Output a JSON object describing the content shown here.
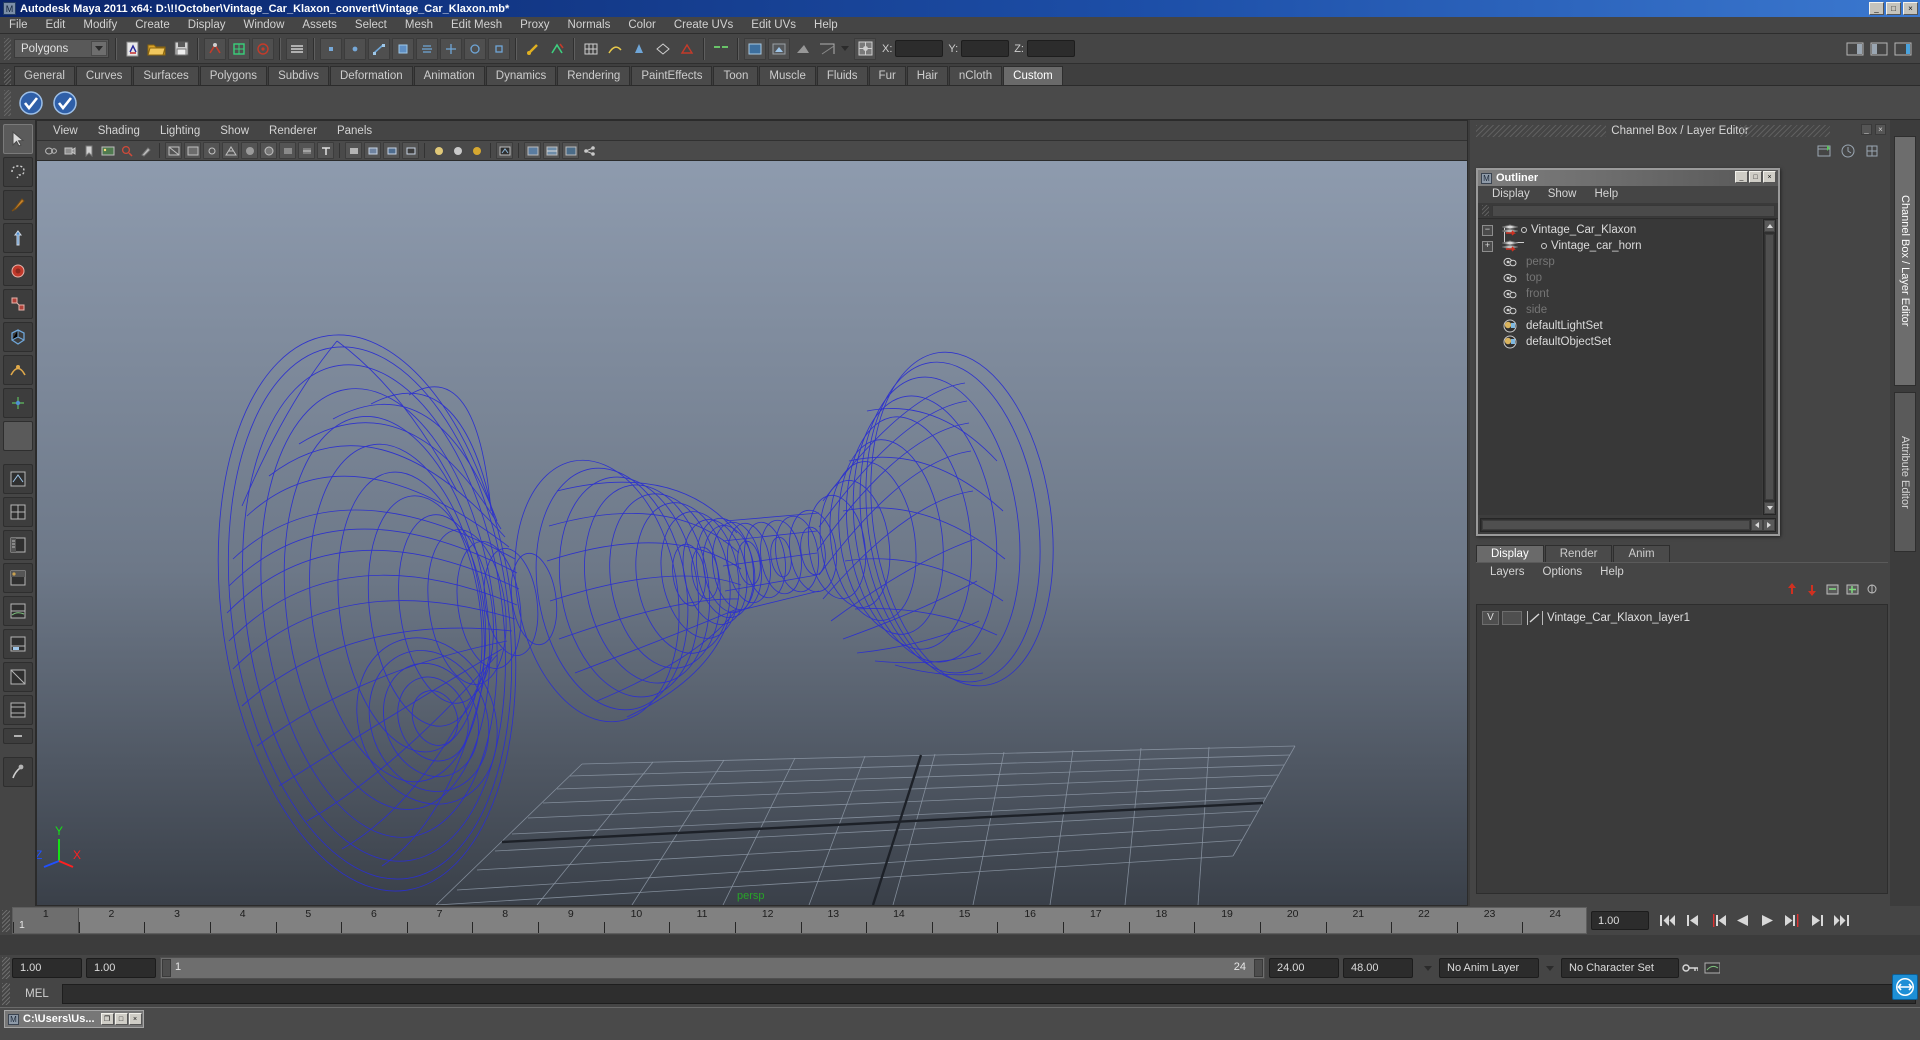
{
  "window": {
    "title": "Autodesk Maya 2011 x64: D:\\!!October\\Vintage_Car_Klaxon_convert\\Vintage_Car_Klaxon.mb*",
    "app_icon": "maya-icon",
    "minimize": "_",
    "maximize": "□",
    "close": "×"
  },
  "menubar": {
    "items": [
      {
        "label": "File"
      },
      {
        "label": "Edit"
      },
      {
        "label": "Modify"
      },
      {
        "label": "Create"
      },
      {
        "label": "Display"
      },
      {
        "label": "Window"
      },
      {
        "label": "Assets"
      },
      {
        "label": "Select"
      },
      {
        "label": "Mesh"
      },
      {
        "label": "Edit Mesh"
      },
      {
        "label": "Proxy"
      },
      {
        "label": "Normals"
      },
      {
        "label": "Color"
      },
      {
        "label": "Create UVs"
      },
      {
        "label": "Edit UVs"
      },
      {
        "label": "Help"
      }
    ]
  },
  "statusline": {
    "mode_selector": {
      "value": "Polygons",
      "icon": "chevron-down-icon"
    },
    "coords": {
      "x_label": "X:",
      "y_label": "Y:",
      "z_label": "Z:",
      "x_value": "",
      "y_value": "",
      "z_value": ""
    }
  },
  "shelf": {
    "tabs": [
      {
        "label": "General",
        "active": false
      },
      {
        "label": "Curves",
        "active": false
      },
      {
        "label": "Surfaces",
        "active": false
      },
      {
        "label": "Polygons",
        "active": false
      },
      {
        "label": "Subdivs",
        "active": false
      },
      {
        "label": "Deformation",
        "active": false
      },
      {
        "label": "Animation",
        "active": false
      },
      {
        "label": "Dynamics",
        "active": false
      },
      {
        "label": "Rendering",
        "active": false
      },
      {
        "label": "PaintEffects",
        "active": false
      },
      {
        "label": "Toon",
        "active": false
      },
      {
        "label": "Muscle",
        "active": false
      },
      {
        "label": "Fluids",
        "active": false
      },
      {
        "label": "Fur",
        "active": false
      },
      {
        "label": "Hair",
        "active": false
      },
      {
        "label": "nCloth",
        "active": false
      },
      {
        "label": "Custom",
        "active": true
      }
    ],
    "buttons": [
      {
        "name": "check-shelf-button-1"
      },
      {
        "name": "check-shelf-button-2"
      }
    ]
  },
  "viewport": {
    "menus": [
      {
        "label": "View"
      },
      {
        "label": "Shading"
      },
      {
        "label": "Lighting"
      },
      {
        "label": "Show"
      },
      {
        "label": "Renderer"
      },
      {
        "label": "Panels"
      }
    ],
    "camera_label": "persp",
    "axis": {
      "x": "X",
      "y": "Y",
      "z": "Z"
    },
    "model_color": "#2b2fcf",
    "bg_top": "#8c99ad",
    "bg_bottom": "#55606f"
  },
  "channelbox": {
    "title": "Channel Box / Layer Editor",
    "min": "_",
    "max": "□",
    "close": "×"
  },
  "outliner": {
    "title": "Outliner",
    "icon": "maya-icon",
    "titlebuttons": {
      "min": "_",
      "max": "□",
      "close": "×"
    },
    "menus": [
      {
        "label": "Display"
      },
      {
        "label": "Show"
      },
      {
        "label": "Help"
      }
    ],
    "items": [
      {
        "label": "Vintage_Car_Klaxon",
        "expander": "−",
        "icon": "transform-icon",
        "dim": false,
        "indent": false
      },
      {
        "label": "Vintage_car_horn",
        "expander": "+",
        "icon": "transform-icon",
        "dim": false,
        "indent": true
      },
      {
        "label": "persp",
        "expander": "",
        "icon": "camera-icon",
        "dim": true,
        "indent": false
      },
      {
        "label": "top",
        "expander": "",
        "icon": "camera-icon",
        "dim": true,
        "indent": false
      },
      {
        "label": "front",
        "expander": "",
        "icon": "camera-icon",
        "dim": true,
        "indent": false
      },
      {
        "label": "side",
        "expander": "",
        "icon": "camera-icon",
        "dim": true,
        "indent": false
      },
      {
        "label": "defaultLightSet",
        "expander": "",
        "icon": "set-icon",
        "dim": false,
        "indent": false
      },
      {
        "label": "defaultObjectSet",
        "expander": "",
        "icon": "set-icon",
        "dim": false,
        "indent": false
      }
    ]
  },
  "layereditor": {
    "tabs": [
      {
        "label": "Display",
        "active": true
      },
      {
        "label": "Render",
        "active": false
      },
      {
        "label": "Anim",
        "active": false
      }
    ],
    "menus": [
      {
        "label": "Layers"
      },
      {
        "label": "Options"
      },
      {
        "label": "Help"
      }
    ],
    "layers": [
      {
        "visibility": "V",
        "type": "",
        "name": "Vintage_Car_Klaxon_layer1"
      }
    ]
  },
  "sidetabs": [
    {
      "label": "Channel Box / Layer Editor",
      "active": true
    },
    {
      "label": "Attribute Editor",
      "active": false
    }
  ],
  "timeslider": {
    "current_frame": "1",
    "current_time_field": "1.00",
    "ticks": [
      "1",
      "2",
      "3",
      "4",
      "5",
      "6",
      "7",
      "8",
      "9",
      "10",
      "11",
      "12",
      "13",
      "14",
      "15",
      "16",
      "17",
      "18",
      "19",
      "20",
      "21",
      "22",
      "23",
      "24"
    ],
    "playback_buttons": [
      {
        "name": "go-to-start-button",
        "glyph": "go-to-start-icon"
      },
      {
        "name": "step-back-key-button",
        "glyph": "step-back-key-icon"
      },
      {
        "name": "step-back-frame-button",
        "glyph": "step-back-frame-icon"
      },
      {
        "name": "play-backwards-button",
        "glyph": "play-backwards-icon"
      },
      {
        "name": "play-forwards-button",
        "glyph": "play-forwards-icon"
      },
      {
        "name": "step-forward-frame-button",
        "glyph": "step-forward-frame-icon"
      },
      {
        "name": "step-forward-key-button",
        "glyph": "step-forward-key-icon"
      },
      {
        "name": "go-to-end-button",
        "glyph": "go-to-end-icon"
      }
    ]
  },
  "rangeslider": {
    "anim_start": "1.00",
    "range_start": "1.00",
    "bar_start_label": "1",
    "bar_end_label": "24",
    "range_end": "24.00",
    "anim_end": "48.00",
    "anim_layer": "No Anim Layer",
    "character_set": "No Character Set"
  },
  "command_line": {
    "label": "MEL",
    "value": "",
    "placeholder": ""
  },
  "taskbar": {
    "window": {
      "icon": "maya-icon",
      "title": "C:\\Users\\Us...",
      "restore": "❐",
      "maximize": "□",
      "close": "×"
    },
    "help_button": "help-icon"
  }
}
